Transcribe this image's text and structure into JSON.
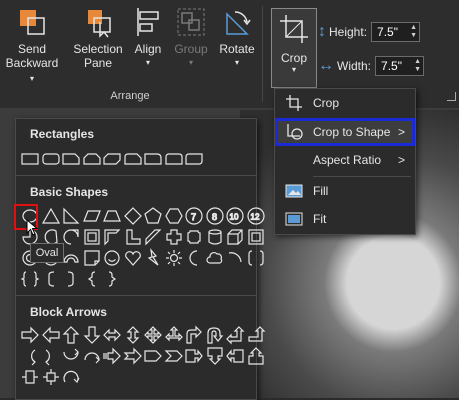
{
  "ribbon": {
    "send_backward": {
      "line1": "Send",
      "line2": "Backward"
    },
    "selection_pane": {
      "line1": "Selection",
      "line2": "Pane"
    },
    "align": {
      "label": "Align"
    },
    "group": {
      "label": "Group"
    },
    "rotate": {
      "label": "Rotate"
    },
    "arrange_group_label": "Arrange",
    "crop": {
      "label": "Crop"
    },
    "height": {
      "label": "Height:",
      "value": "7.5\""
    },
    "width": {
      "label": "Width:",
      "value": "7.5\""
    }
  },
  "shapes_gallery": {
    "rectangles_title": "Rectangles",
    "basic_shapes_title": "Basic Shapes",
    "block_arrows_title": "Block Arrows",
    "tooltip": "Oval",
    "number_shapes": [
      "7",
      "8",
      "10",
      "12"
    ]
  },
  "crop_menu": {
    "items": [
      {
        "label": "Crop",
        "icon": "crop-icon"
      },
      {
        "label": "Crop to Shape",
        "icon": "crop-to-shape-icon",
        "selected": true,
        "submenu": true
      },
      {
        "label": "Aspect Ratio",
        "submenu": true
      },
      {
        "label": "Fill",
        "icon": "fill-icon"
      },
      {
        "label": "Fit",
        "icon": "fit-icon"
      }
    ]
  },
  "colors": {
    "accent_orange": "#e8883a",
    "selection_blue": "#1a2bd6",
    "highlight_red": "#e01010",
    "icon_blue": "#5b9bd5"
  }
}
